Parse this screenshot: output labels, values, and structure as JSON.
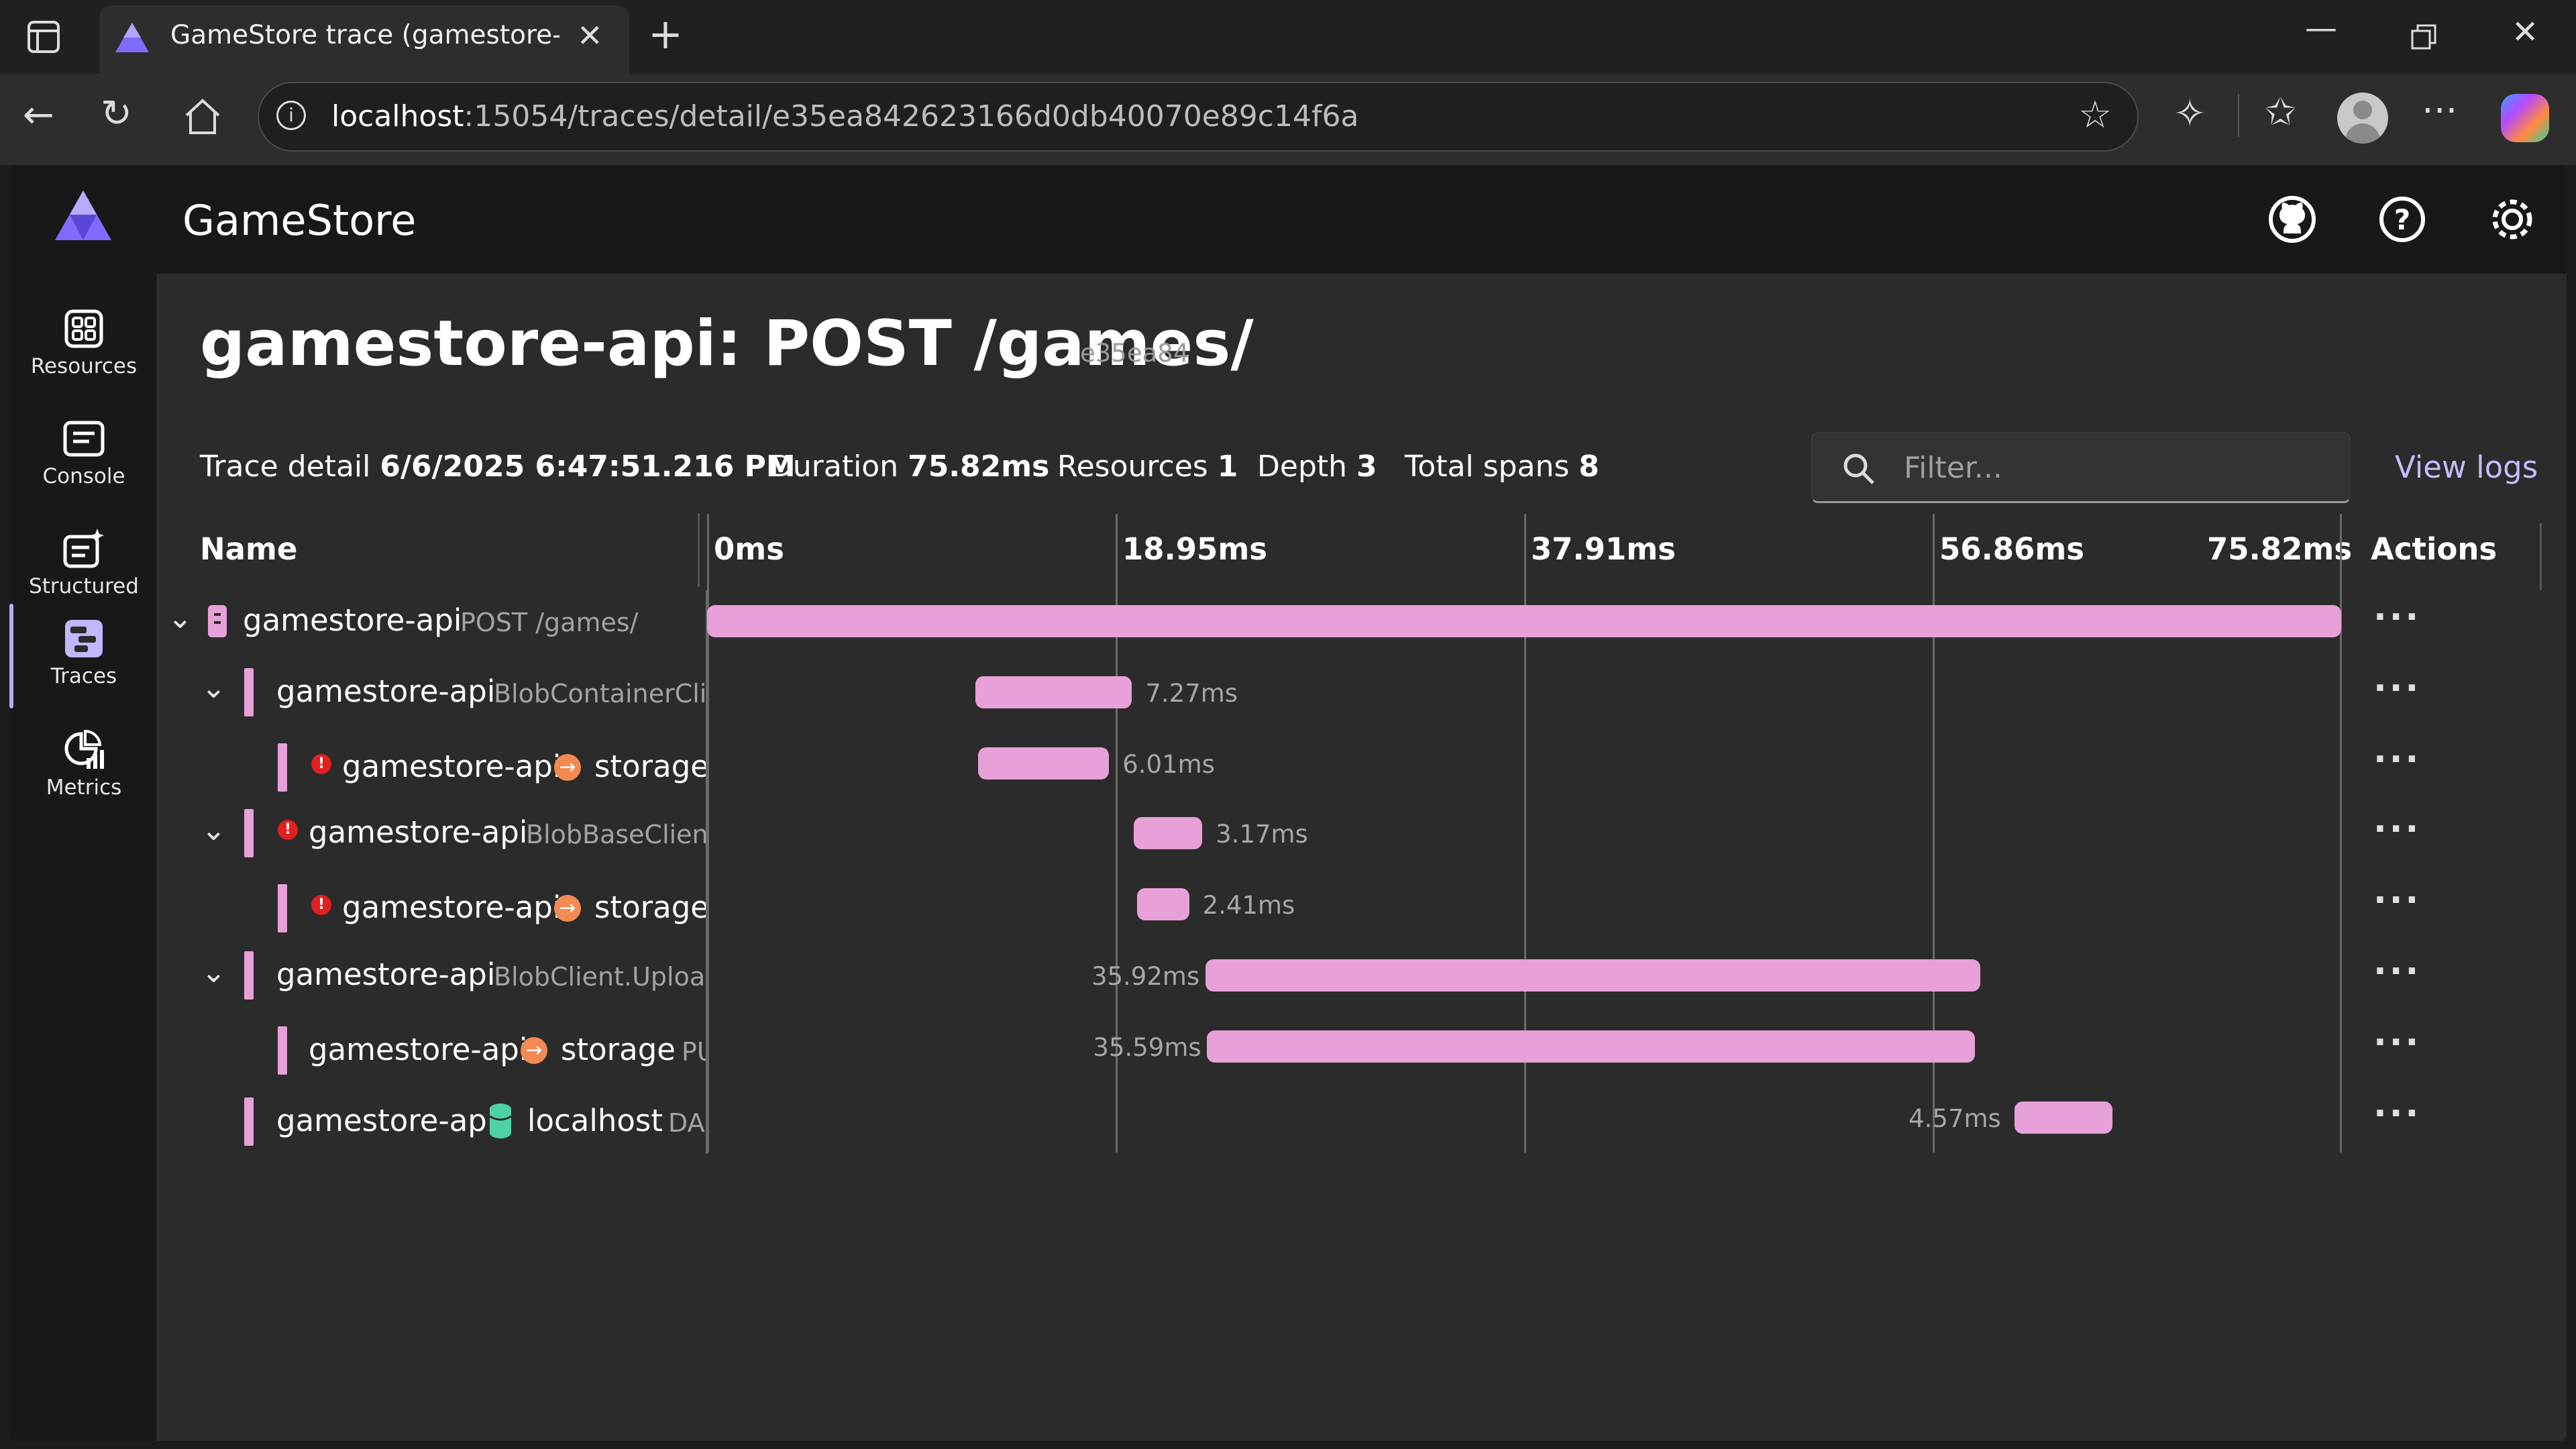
{
  "browser": {
    "tab_title": "GameStore trace (gamestore-api:",
    "url_host": "localhost",
    "url_path": ":15054/traces/detail/e35ea842623166d0db40070e89c14f6a"
  },
  "app": {
    "name": "GameStore",
    "nav": [
      {
        "label": "Resources",
        "icon": "resources-icon"
      },
      {
        "label": "Console",
        "icon": "console-icon"
      },
      {
        "label": "Structured",
        "icon": "structured-icon"
      },
      {
        "label": "Traces",
        "icon": "traces-icon"
      },
      {
        "label": "Metrics",
        "icon": "metrics-icon"
      }
    ]
  },
  "trace": {
    "title": "gamestore-api: POST /games/",
    "short_id": "e35ea84",
    "detail_label": "Trace detail",
    "detail_value": "6/6/2025 6:47:51.216 PM",
    "duration_label": "Duration",
    "duration_value": "75.82ms",
    "resources_label": "Resources",
    "resources_value": "1",
    "depth_label": "Depth",
    "depth_value": "3",
    "spans_label": "Total spans",
    "spans_value": "8",
    "filter_placeholder": "Filter...",
    "view_logs": "View logs"
  },
  "table": {
    "name_header": "Name",
    "actions_header": "Actions",
    "ticks": [
      "0ms",
      "18.95ms",
      "37.91ms",
      "56.86ms",
      "75.82ms"
    ],
    "total_ms": 75.82,
    "rows": [
      {
        "service": "gamestore-api",
        "op": "POST /games/",
        "peer": "",
        "duration": "",
        "start_fraction": 0.0,
        "width_fraction": 1.0,
        "error": false
      },
      {
        "service": "gamestore-api",
        "op": "BlobContainerClie",
        "peer": "",
        "duration": "7.27ms",
        "start_fraction": 0.164,
        "width_fraction": 0.096,
        "error": false
      },
      {
        "service": "gamestore-api",
        "op": "",
        "peer": "storage",
        "duration": "6.01ms",
        "start_fraction": 0.166,
        "width_fraction": 0.08,
        "error": true
      },
      {
        "service": "gamestore-api",
        "op": "BlobBaseClient.",
        "peer": "",
        "duration": "3.17ms",
        "start_fraction": 0.261,
        "width_fraction": 0.042,
        "error": true
      },
      {
        "service": "gamestore-api",
        "op": "",
        "peer": "storage",
        "duration": "2.41ms",
        "start_fraction": 0.263,
        "width_fraction": 0.032,
        "error": true
      },
      {
        "service": "gamestore-api",
        "op": "BlobClient.Upload",
        "peer": "",
        "duration": "35.92ms",
        "start_fraction": 0.305,
        "width_fraction": 0.474,
        "error": false
      },
      {
        "service": "gamestore-api",
        "op": "PU",
        "peer": "storage",
        "duration": "35.59ms",
        "start_fraction": 0.306,
        "width_fraction": 0.47,
        "error": false
      },
      {
        "service": "gamestore-api",
        "op": "DA",
        "peer": "localhost",
        "duration": "4.57ms",
        "start_fraction": 0.8,
        "width_fraction": 0.06,
        "error": false
      }
    ]
  }
}
